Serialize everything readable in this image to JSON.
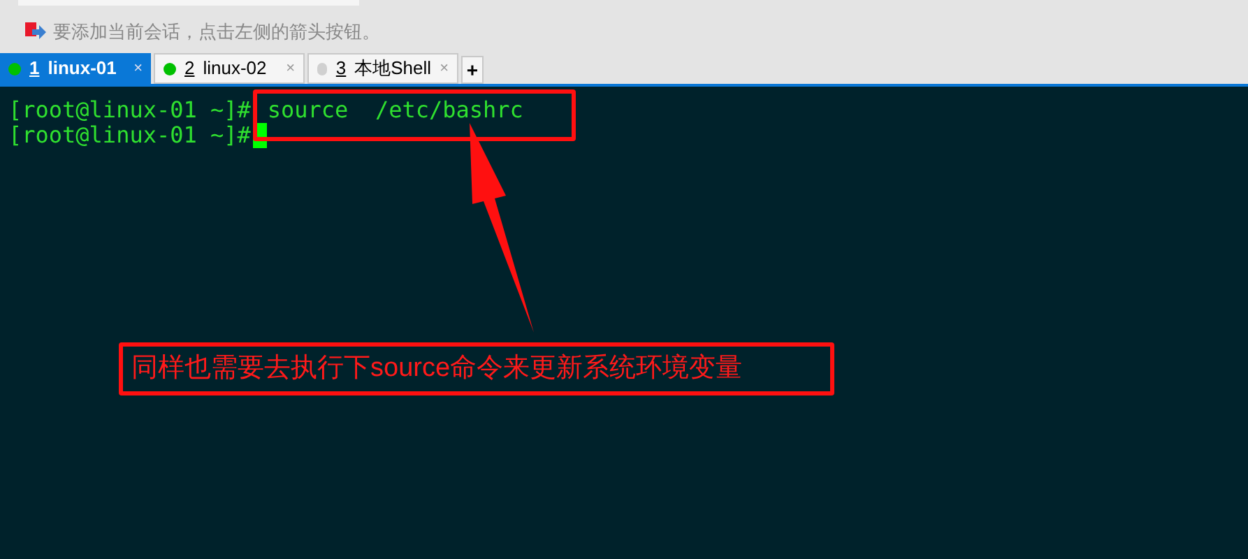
{
  "hint_bar": {
    "text": "要添加当前会话，点击左侧的箭头按钮。"
  },
  "tabs": [
    {
      "number": "1",
      "label": "linux-01",
      "selected": true,
      "color": "#00c000",
      "close": "×"
    },
    {
      "number": "2",
      "label": "linux-02",
      "selected": false,
      "color": "#00c000",
      "close": "×"
    },
    {
      "number": "3",
      "label": "本地Shell",
      "selected": false,
      "color": "#d0d0d0",
      "close": "×"
    }
  ],
  "new_tab": "+",
  "terminal": {
    "lines": [
      {
        "prompt": "[root@linux-01 ~]#",
        "command": "source  /etc/bashrc",
        "cursor": false
      },
      {
        "prompt": "[root@linux-01 ~]#",
        "cursor": true
      }
    ]
  },
  "annotation": {
    "text": "同样也需要去执行下source命令来更新系统环境变量"
  }
}
